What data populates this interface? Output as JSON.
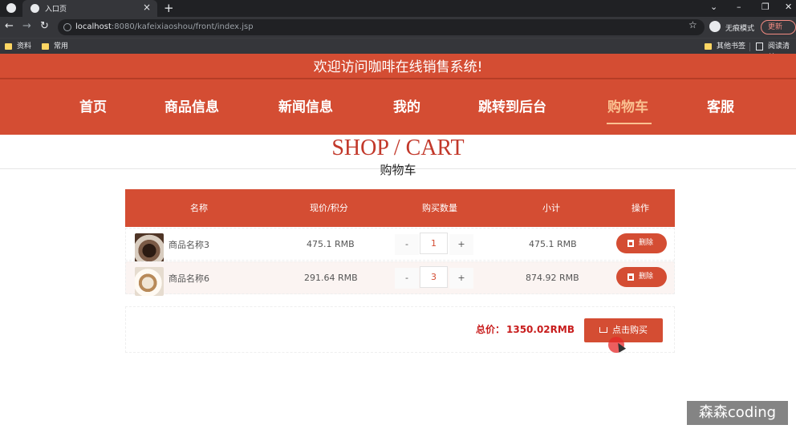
{
  "browser": {
    "tab_title": "入口页",
    "close_glyph": "×",
    "new_tab_glyph": "+",
    "url_host": "localhost",
    "url_rest": ":8080/kafeixiaoshou/front/index.jsp",
    "incognito_label": "无痕模式",
    "update_label": "更新",
    "bookmarks": [
      "资料",
      "常用"
    ],
    "bookmarks_right": [
      "其他书签",
      "阅读清单"
    ],
    "icons": [
      "back-arrow-icon",
      "forward-arrow-icon",
      "reload-icon",
      "info-icon",
      "star-icon",
      "incognito-icon"
    ]
  },
  "header": {
    "welcome": "欢迎访问咖啡在线销售系统!",
    "nav": [
      "首页",
      "商品信息",
      "新闻信息",
      "我的",
      "跳转到后台",
      "购物车",
      "客服"
    ],
    "active_index": 5
  },
  "page": {
    "title_en": "SHOP / CART",
    "title_cn": "购物车"
  },
  "cart": {
    "columns": [
      "名称",
      "现价/积分",
      "购买数量",
      "小计",
      "操作"
    ],
    "rows": [
      {
        "name": "商品名称3",
        "price": "475.1 RMB",
        "qty": "1",
        "subtotal": "475.1 RMB",
        "delete_label": "删除"
      },
      {
        "name": "商品名称6",
        "price": "291.64 RMB",
        "qty": "3",
        "subtotal": "874.92 RMB",
        "delete_label": "删除"
      }
    ],
    "minus_glyph": "-",
    "plus_glyph": "+"
  },
  "summary": {
    "total_label": "总价：",
    "total_value": "1350.02RMB",
    "buy_label": "点击购买"
  },
  "watermark": "森森coding",
  "colors": {
    "brand": "#d44d33",
    "active_nav": "#fac191",
    "total": "#c81d1d"
  }
}
